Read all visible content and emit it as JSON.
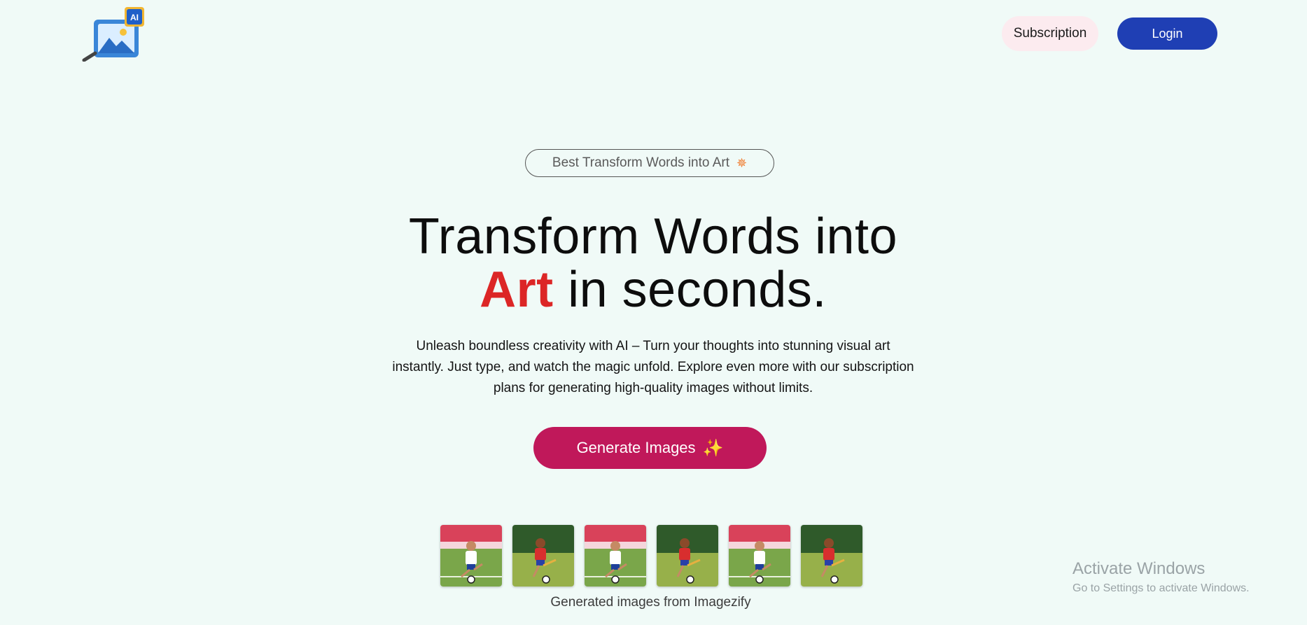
{
  "header": {
    "logo_badge": "AI",
    "subscription_label": "Subscription",
    "login_label": "Login"
  },
  "hero": {
    "badge_text": "Best Transform Words into Art",
    "title_line1": "Transform Words into",
    "title_accent": "Art",
    "title_line2_rest": " in seconds.",
    "description": "Unleash boundless creativity with AI – Turn your thoughts into stunning visual art instantly. Just type, and watch the magic unfold. Explore even more with our subscription plans for generating high-quality images without limits.",
    "cta_label": "Generate Images",
    "cta_icon": "sparkles-icon",
    "badge_icon": "star-icon"
  },
  "gallery": {
    "images": [
      {
        "variant": "white-kit"
      },
      {
        "variant": "red-kit"
      },
      {
        "variant": "white-kit"
      },
      {
        "variant": "red-kit"
      },
      {
        "variant": "white-kit"
      },
      {
        "variant": "red-kit"
      }
    ],
    "caption": "Generated images from Imagezify"
  },
  "os_watermark": {
    "title": "Activate Windows",
    "subtitle": "Go to Settings to activate Windows."
  },
  "colors": {
    "background": "#f0faf7",
    "login": "#1f3fb4",
    "subscription": "#fcebef",
    "cta": "#c0185a",
    "accent": "#dc2626"
  }
}
